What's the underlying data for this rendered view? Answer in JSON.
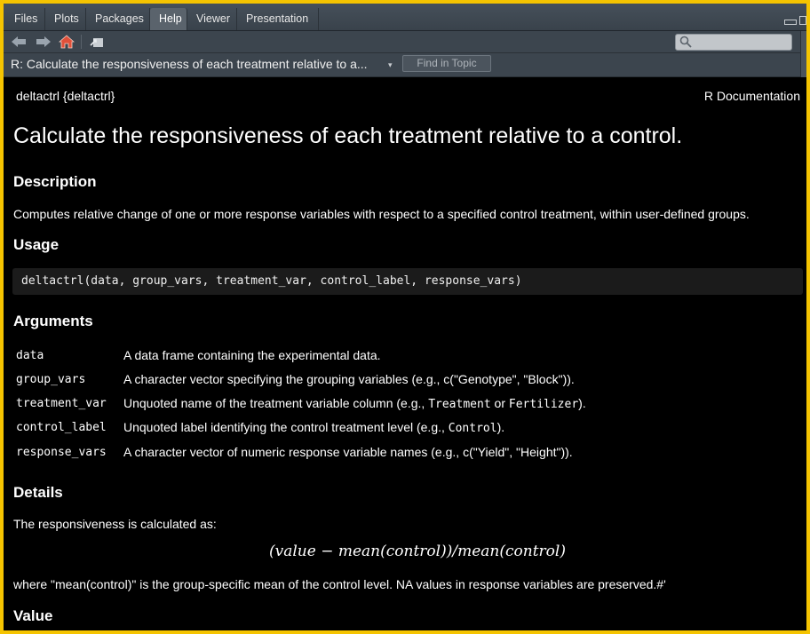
{
  "tabs": [
    "Files",
    "Plots",
    "Packages",
    "Help",
    "Viewer",
    "Presentation"
  ],
  "active_tab": "Help",
  "topic": {
    "title": "R: Calculate the responsiveness of each treatment relative to a...",
    "find_button": "Find in Topic"
  },
  "doc": {
    "header_left": "deltactrl {deltactrl}",
    "header_right": "R Documentation",
    "title": "Calculate the responsiveness of each treatment relative to a control.",
    "description_heading": "Description",
    "description": "Computes relative change of one or more response variables with respect to a specified control treatment, within user-defined groups.",
    "usage_heading": "Usage",
    "usage_code": "deltactrl(data, group_vars, treatment_var, control_label, response_vars)",
    "arguments_heading": "Arguments",
    "arguments": [
      {
        "name": "data",
        "desc": "A data frame containing the experimental data."
      },
      {
        "name": "group_vars",
        "desc": "A character vector specifying the grouping variables (e.g., c(\"Genotype\", \"Block\"))."
      },
      {
        "name": "treatment_var",
        "desc_pre": "Unquoted name of the treatment variable column (e.g., ",
        "code1": "Treatment",
        "mid": " or ",
        "code2": "Fertilizer",
        "post": ")."
      },
      {
        "name": "control_label",
        "desc_pre": "Unquoted label identifying the control treatment level (e.g., ",
        "code1": "Control",
        "post": ")."
      },
      {
        "name": "response_vars",
        "desc": "A character vector of numeric response variable names (e.g., c(\"Yield\", \"Height\"))."
      }
    ],
    "details_heading": "Details",
    "details_intro": "The responsiveness is calculated as:",
    "formula": "(value − mean(control))/mean(control)",
    "details_after": "where \"mean(control)\" is the group-specific mean of the control level. NA values in response variables are preserved.#'",
    "value_heading": "Value"
  },
  "colors": {
    "frame_border": "#f5c400",
    "background": "#000000",
    "code_bg": "#1b1b1b",
    "home_icon": "#e0503a"
  }
}
